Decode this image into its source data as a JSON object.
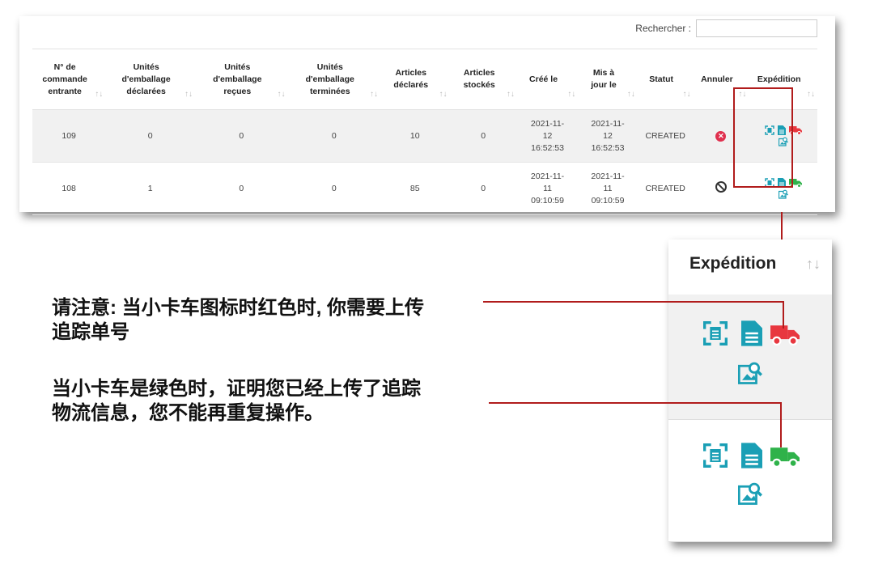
{
  "search": {
    "label": "Rechercher :",
    "value": ""
  },
  "table": {
    "headers": [
      [
        "N° de",
        "commande",
        "entrante"
      ],
      [
        "Unités",
        "d'emballage",
        "déclarées"
      ],
      [
        "Unités",
        "d'emballage",
        "reçues"
      ],
      [
        "Unités",
        "d'emballage",
        "terminées"
      ],
      [
        "Articles",
        "déclarés"
      ],
      [
        "Articles",
        "stockés"
      ],
      [
        "Créé le"
      ],
      [
        "Mis à",
        "jour le"
      ],
      [
        "Statut"
      ],
      [
        "Annuler"
      ],
      [
        "Expédition"
      ]
    ],
    "sort_icon": "↑↓",
    "sort_icon_active": "↑↓",
    "rows": [
      {
        "order_no": "109",
        "declared_units": "0",
        "received_units": "0",
        "finished_units": "0",
        "declared_articles": "10",
        "stocked_articles": "0",
        "created": [
          "2021-11-",
          "12",
          "16:52:53"
        ],
        "updated": [
          "2021-11-",
          "12",
          "16:52:53"
        ],
        "status": "CREATED",
        "cancel_icon": "cancel-red-icon",
        "truck_color": "#e8373f"
      },
      {
        "order_no": "108",
        "declared_units": "1",
        "received_units": "0",
        "finished_units": "0",
        "declared_articles": "85",
        "stocked_articles": "0",
        "created": [
          "2021-11-",
          "11",
          "09:10:59"
        ],
        "updated": [
          "2021-11-",
          "11",
          "09:10:59"
        ],
        "status": "CREATED",
        "cancel_icon": "ban-icon",
        "truck_color": "#2fb24a"
      }
    ]
  },
  "zoom": {
    "title": "Expédition",
    "sort_icon": "↑↓"
  },
  "notes": {
    "red_line1": "请注意: 当小卡车图标时红色时, 你需要上传",
    "red_line2": "追踪单号",
    "green_line1": "当小卡车是绿色时，证明您已经上传了追踪",
    "green_line2": "物流信息，您不能再重复操作。"
  },
  "colors": {
    "icon_teal": "#1a9fb5",
    "truck_red": "#e8373f",
    "truck_green": "#2fb24a",
    "highlight": "#b11c1c"
  }
}
